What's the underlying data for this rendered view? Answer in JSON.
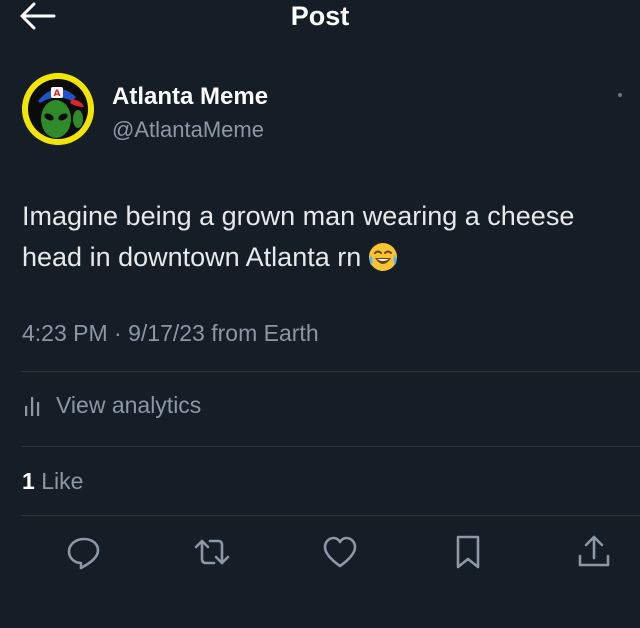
{
  "header": {
    "title": "Post",
    "back_icon": "arrow-left-icon"
  },
  "author": {
    "name": "Atlanta Meme",
    "handle": "@AtlantaMeme",
    "avatar_icon": "alien-avatar"
  },
  "tweet": {
    "text": "Imagine being a grown man wearing a cheese head in downtown Atlanta rn",
    "emoji": "face-with-tears-of-joy"
  },
  "meta": {
    "time": "4:23 PM",
    "dot": "·",
    "date": "9/17/23",
    "source": "from Earth"
  },
  "analytics": {
    "label": "View analytics",
    "icon": "bar-chart-icon"
  },
  "likes": {
    "count": "1",
    "label": "Like"
  },
  "actions": [
    {
      "icon": "reply-icon"
    },
    {
      "icon": "retweet-icon"
    },
    {
      "icon": "heart-icon"
    },
    {
      "icon": "bookmark-icon"
    },
    {
      "icon": "share-icon"
    }
  ],
  "colors": {
    "background": "#151d27",
    "text": "#e7e9ea",
    "muted": "#8b98a5",
    "divider": "#2f3336",
    "avatar_ring": "#f2e600"
  }
}
